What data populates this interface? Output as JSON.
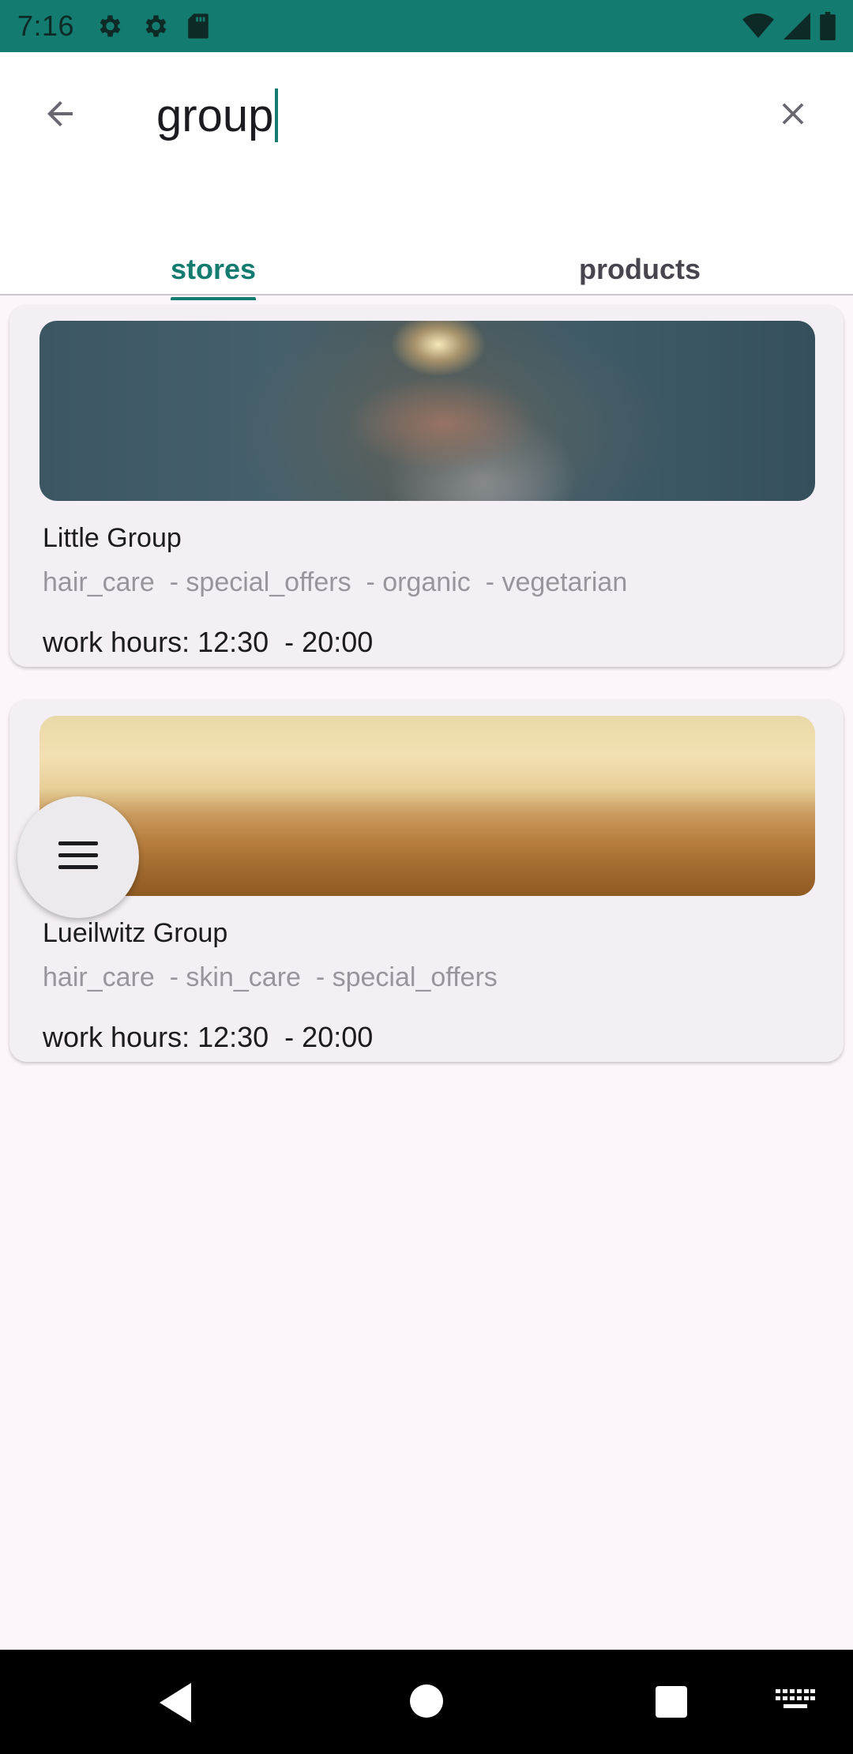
{
  "status_bar": {
    "time": "7:16",
    "left_icons": [
      "gear-icon",
      "gear-icon",
      "sd-card-icon"
    ],
    "right_icons": [
      "wifi-icon",
      "signal-icon",
      "battery-icon"
    ],
    "bg_color": "#137B6F"
  },
  "search": {
    "value": "group",
    "back_icon": "arrow-back-icon",
    "clear_icon": "close-icon"
  },
  "tabs": [
    {
      "label": "stores",
      "active": true
    },
    {
      "label": "products",
      "active": false
    }
  ],
  "accent_color": "#137B6F",
  "stores": [
    {
      "name": "Little Group",
      "image": "sparkler-photo",
      "tags": [
        "hair_care",
        " - special_offers",
        " - organic",
        " - vegetarian"
      ],
      "hours_label": "work hours: ",
      "hours_open": "12:30",
      "hours_sep": "  - ",
      "hours_close": "20:00"
    },
    {
      "name": "Lueilwitz Group",
      "image": "horizon-photo",
      "tags": [
        "hair_care",
        " - skin_care",
        " - special_offers"
      ],
      "hours_label": "work hours: ",
      "hours_open": "12:30",
      "hours_sep": "  - ",
      "hours_close": "20:00"
    }
  ],
  "fab": {
    "icon": "menu-icon"
  },
  "nav_bar": {
    "icons": [
      "nav-back-icon",
      "nav-home-icon",
      "nav-recents-icon",
      "keyboard-icon"
    ]
  }
}
